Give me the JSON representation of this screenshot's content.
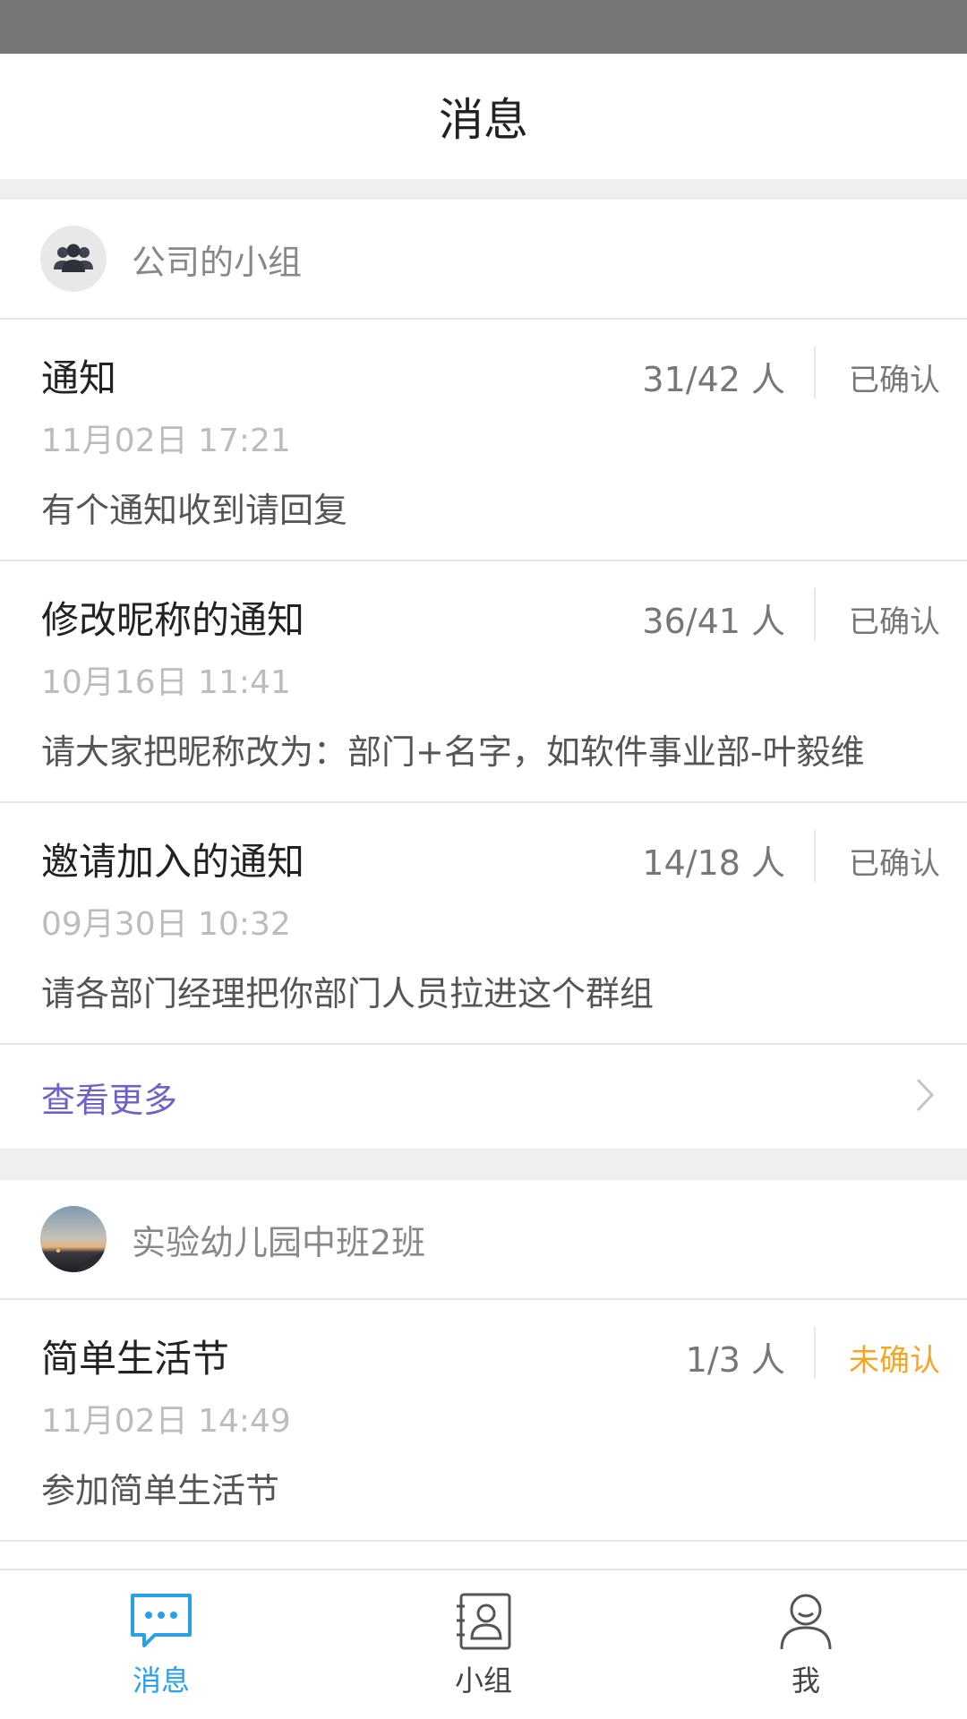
{
  "header": {
    "title": "消息"
  },
  "groups": [
    {
      "name": "公司的小组",
      "avatar_icon": "group-people-icon",
      "messages": [
        {
          "title": "通知",
          "count": "31/42 人",
          "status": "已确认",
          "time": "11月02日 17:21",
          "body": "有个通知收到请回复"
        },
        {
          "title": "修改昵称的通知",
          "count": "36/41 人",
          "status": "已确认",
          "time": "10月16日 11:41",
          "body": "请大家把昵称改为：部门+名字，如软件事业部-叶毅维"
        },
        {
          "title": "邀请加入的通知",
          "count": "14/18 人",
          "status": "已确认",
          "time": "09月30日 10:32",
          "body": "请各部门经理把你部门人员拉进这个群组"
        }
      ],
      "more_label": "查看更多"
    },
    {
      "name": "实验幼儿园中班2班",
      "avatar_icon": "landscape-photo-avatar",
      "messages": [
        {
          "title": "简单生活节",
          "count": "1/3 人",
          "status": "未确认",
          "time": "11月02日 14:49",
          "body": "参加简单生活节"
        }
      ]
    }
  ],
  "tabs": [
    {
      "label": "消息",
      "icon": "chat-bubble-icon",
      "active": true
    },
    {
      "label": "小组",
      "icon": "contact-card-icon",
      "active": false
    },
    {
      "label": "我",
      "icon": "person-icon",
      "active": false
    }
  ],
  "colors": {
    "accent": "#2aa0e8",
    "link": "#6e62c8",
    "pending": "#f5a623",
    "status_bar": "#767676"
  }
}
